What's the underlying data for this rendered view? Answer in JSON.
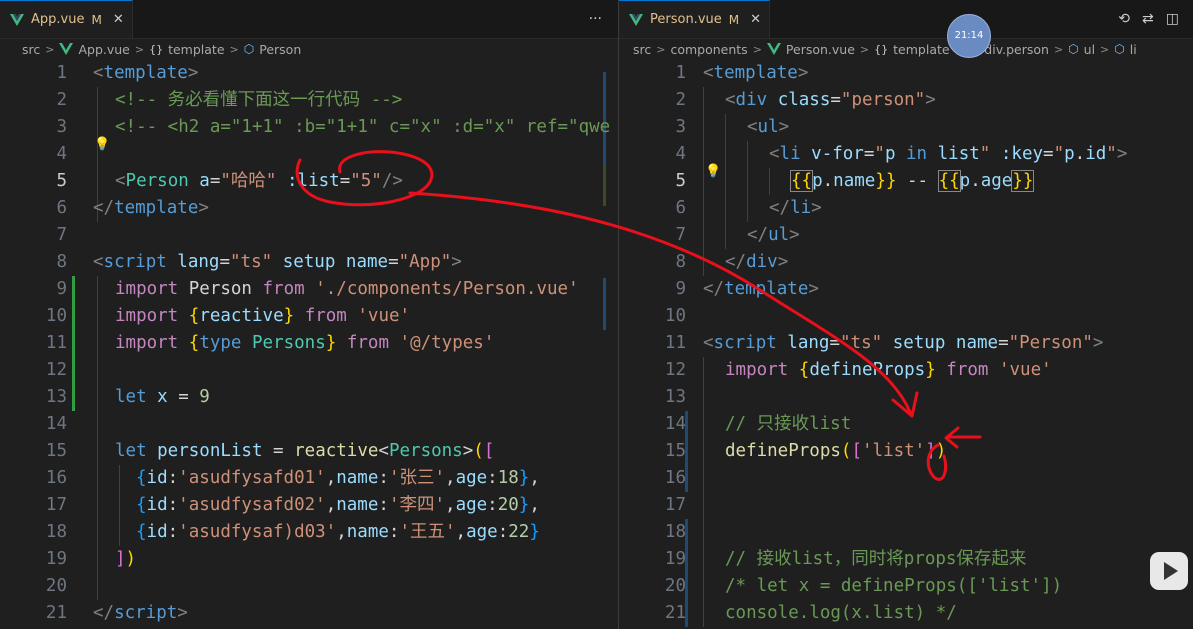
{
  "left": {
    "tab": {
      "name": "App.vue",
      "modified": "M",
      "close": "✕",
      "more": "···"
    },
    "breadcrumb": [
      "src",
      "App.vue",
      "template",
      "Person"
    ],
    "lines": [
      {
        "n": "1"
      },
      {
        "n": "2"
      },
      {
        "n": "3"
      },
      {
        "n": "4"
      },
      {
        "n": "5"
      },
      {
        "n": "6"
      },
      {
        "n": "7"
      },
      {
        "n": "8"
      },
      {
        "n": "9"
      },
      {
        "n": "10"
      },
      {
        "n": "11"
      },
      {
        "n": "12"
      },
      {
        "n": "13"
      },
      {
        "n": "14"
      },
      {
        "n": "15"
      },
      {
        "n": "16"
      },
      {
        "n": "17"
      },
      {
        "n": "18"
      },
      {
        "n": "19"
      },
      {
        "n": "20"
      },
      {
        "n": "21"
      }
    ],
    "code": {
      "l1": [
        "<",
        "template",
        ">"
      ],
      "l2": "<!-- 务必看懂下面这一行代码 -->",
      "l3": "<!-- <h2 a=\"1+1\" :b=\"1+1\" c=\"x\" :d=\"x\" ref=\"qwe",
      "l5": [
        "<",
        "Person",
        " a",
        "=",
        "\"哈哈\"",
        " :list",
        "=",
        "\"5\"",
        "/>"
      ],
      "l6": [
        "</",
        "template",
        ">"
      ],
      "l8": [
        "<",
        "script",
        " lang",
        "=",
        "\"ts\"",
        " setup",
        " name",
        "=",
        "\"App\"",
        ">"
      ],
      "l9": [
        "import",
        " Person ",
        "from",
        " './components/Person.vue'"
      ],
      "l10": [
        "import",
        " ",
        "{",
        "reactive",
        "}",
        " from",
        " 'vue'"
      ],
      "l11": [
        "import",
        " ",
        "{",
        "type",
        " Persons",
        "}",
        " from",
        " '@/types'"
      ],
      "l13": [
        "let",
        " x ",
        "=",
        " 9"
      ],
      "l15": [
        "let",
        " personList ",
        "=",
        " reactive",
        "<",
        "Persons",
        ">",
        "(",
        "["
      ],
      "l16": [
        "{",
        "id",
        ":",
        "'asudfysafd01'",
        ",",
        "name",
        ":",
        "'张三'",
        ",",
        "age",
        ":",
        "18",
        "}",
        ","
      ],
      "l17": [
        "{",
        "id",
        ":",
        "'asudfysafd02'",
        ",",
        "name",
        ":",
        "'李四'",
        ",",
        "age",
        ":",
        "20",
        "}",
        ","
      ],
      "l18": [
        "{",
        "id",
        ":",
        "'asudfysaf)d03'",
        ",",
        "name",
        ":",
        "'王五'",
        ",",
        "age",
        ":",
        "22",
        "}"
      ],
      "l19": [
        "]",
        ")"
      ],
      "l21": [
        "</",
        "script",
        ">"
      ]
    }
  },
  "right": {
    "tab": {
      "name": "Person.vue",
      "modified": "M",
      "close": "✕"
    },
    "breadcrumb": [
      "src",
      "components",
      "Person.vue",
      "template",
      "div.person",
      "ul",
      "li"
    ],
    "lines": [
      {
        "n": "1"
      },
      {
        "n": "2"
      },
      {
        "n": "3"
      },
      {
        "n": "4"
      },
      {
        "n": "5"
      },
      {
        "n": "6"
      },
      {
        "n": "7"
      },
      {
        "n": "8"
      },
      {
        "n": "9"
      },
      {
        "n": "10"
      },
      {
        "n": "11"
      },
      {
        "n": "12"
      },
      {
        "n": "13"
      },
      {
        "n": "14"
      },
      {
        "n": "15"
      },
      {
        "n": "16"
      },
      {
        "n": "17"
      },
      {
        "n": "18"
      },
      {
        "n": "19"
      },
      {
        "n": "20"
      },
      {
        "n": "21"
      }
    ],
    "code": {
      "l1": [
        "<",
        "template",
        ">"
      ],
      "l2": [
        "<",
        "div",
        " class",
        "=",
        "\"person\"",
        ">"
      ],
      "l3": [
        "<",
        "ul",
        ">"
      ],
      "l4": [
        "<",
        "li",
        " v-for",
        "=",
        "\"",
        "p",
        " in ",
        "list",
        "\"",
        " :key",
        "=",
        "\"",
        "p",
        ".",
        "id",
        "\"",
        ">"
      ],
      "l5": [
        "{{",
        "p",
        ".",
        "name",
        "}}",
        " -- ",
        "{{",
        "p",
        ".",
        "age",
        "}}"
      ],
      "l6": [
        "</",
        "li",
        ">"
      ],
      "l7": [
        "</",
        "ul",
        ">"
      ],
      "l8": [
        "</",
        "div",
        ">"
      ],
      "l9": [
        "</",
        "template",
        ">"
      ],
      "l11": [
        "<",
        "script",
        " lang",
        "=",
        "\"ts\"",
        " setup",
        " name",
        "=",
        "\"Person\"",
        ">"
      ],
      "l12": [
        "import",
        " ",
        "{",
        "defineProps",
        "}",
        " from",
        " 'vue'"
      ],
      "l14": "// 只接收list",
      "l15": [
        "defineProps",
        "(",
        "[",
        "'list'",
        "]",
        ")"
      ],
      "l19": "// 接收list，同时将props保存起来",
      "l20": "/* let x = defineProps(['list'])",
      "l21": "console.log(x.list) */"
    },
    "clock": "21:14"
  }
}
